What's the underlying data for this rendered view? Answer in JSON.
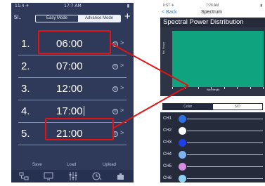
{
  "left_phone": {
    "status": {
      "left": "11:4 ✈",
      "center": "17:7 AM",
      "right": "▮"
    },
    "back_label": "5l..",
    "modes": [
      "Easy Mode",
      "Advance Mode"
    ],
    "selected_mode": "Advance Mode",
    "add_label": "+",
    "schedule": [
      {
        "number": "1.",
        "time": "06:00"
      },
      {
        "number": "2.",
        "time": "07:00"
      },
      {
        "number": "3.",
        "time": "12:00"
      },
      {
        "number": "4.",
        "time": "17:00"
      },
      {
        "number": "5.",
        "time": "21:00"
      }
    ],
    "row_icon_glyph": "①",
    "chevron_glyph": ">",
    "bottom_actions": [
      "Save",
      "Load",
      "Upload"
    ],
    "tabbar_icons": [
      "devices-icon",
      "screen-icon",
      "sliders-icon",
      "timer-icon",
      "puzzle-icon"
    ],
    "highlighted_rows": [
      "06:00",
      "21:00"
    ]
  },
  "right_phone": {
    "status": {
      "left": "k:ST ✈",
      "center": "7:28 AM",
      "right": "▮"
    },
    "back_label": "< Back",
    "title": "Spectrum",
    "chart_header": "Spectral Power Distribution",
    "chart_ylabel": "Rel. Power",
    "chart_xlabel": "Wavelength",
    "chart_fill_color": "#0fa37f",
    "modes": [
      "Color",
      "S/D"
    ],
    "selected_mode": "Color",
    "channels": [
      {
        "label": "CH1",
        "color": "#2f6fe0"
      },
      {
        "label": "CH2",
        "color": "#ffffff"
      },
      {
        "label": "CH3",
        "color": "#1f3fe8"
      },
      {
        "label": "CH4",
        "color": "#7fb3f0"
      },
      {
        "label": "CH5",
        "color": "#d68fe0"
      },
      {
        "label": "CH6",
        "color": "#8fd0f0"
      }
    ]
  },
  "accent_color": "#e41313"
}
